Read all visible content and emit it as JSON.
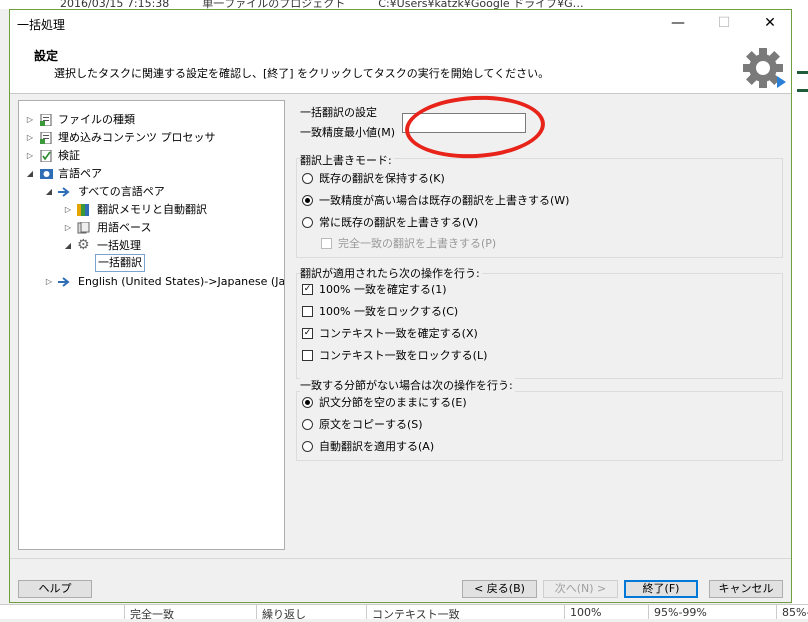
{
  "background": {
    "top_text": "2016/03/15 7:15:38　　　単一ファイルのプロジェクト　　　C:¥Users¥katzk¥Google ドライブ¥G…",
    "bottom_cells": [
      "完全一致",
      "繰り返し",
      "コンテキスト一致",
      "100%",
      "95%-99%",
      "85%-"
    ]
  },
  "window": {
    "title": "一括処理",
    "minimize": "—",
    "maximize": "☐",
    "close": "✕"
  },
  "header": {
    "title": "設定",
    "description": "選択したタスクに関連する設定を確認し、[終了] をクリックしてタスクの実行を開始してください。"
  },
  "tree": {
    "items": [
      {
        "label": "ファイルの種類",
        "arrow": "▷"
      },
      {
        "label": "埋め込みコンテンツ プロセッサ",
        "arrow": "▷"
      },
      {
        "label": "検証",
        "arrow": "▷"
      },
      {
        "label": "言語ペア",
        "arrow": "◢"
      },
      {
        "label": "すべての言語ペア",
        "arrow": "◢"
      },
      {
        "label": "翻訳メモリと自動翻訳",
        "arrow": "▷"
      },
      {
        "label": "用語ベース",
        "arrow": "▷"
      },
      {
        "label": "一括処理",
        "arrow": "◢"
      },
      {
        "label": "一括翻訳",
        "arrow": ""
      },
      {
        "label": "English (United States)->Japanese (Ja",
        "arrow": "▷"
      }
    ]
  },
  "settings": {
    "section_title": "一括翻訳の設定",
    "min_match_label": "一致精度最小値(M)",
    "min_match_value": "",
    "overwrite_mode": {
      "title": "翻訳上書きモード:",
      "options": [
        {
          "label": "既存の翻訳を保持する(K)",
          "selected": false
        },
        {
          "label": "一致精度が高い場合は既存の翻訳を上書きする(W)",
          "selected": true
        },
        {
          "label": "常に既存の翻訳を上書きする(V)",
          "selected": false
        }
      ],
      "sub_option": {
        "label": "完全一致の翻訳を上書きする(P)",
        "checked": false,
        "enabled": false
      }
    },
    "after_apply": {
      "title": "翻訳が適用されたら次の操作を行う:",
      "options": [
        {
          "label": "100% 一致を確定する(1)",
          "checked": true
        },
        {
          "label": "100% 一致をロックする(C)",
          "checked": false
        },
        {
          "label": "コンテキスト一致を確定する(X)",
          "checked": true
        },
        {
          "label": "コンテキスト一致をロックする(L)",
          "checked": false
        }
      ]
    },
    "no_match": {
      "title": "一致する分節がない場合は次の操作を行う:",
      "options": [
        {
          "label": "訳文分節を空のままにする(E)",
          "selected": true
        },
        {
          "label": "原文をコピーする(S)",
          "selected": false
        },
        {
          "label": "自動翻訳を適用する(A)",
          "selected": false
        }
      ]
    }
  },
  "footer": {
    "help": "ヘルプ",
    "back": "< 戻る(B)",
    "next": "次へ(N) >",
    "finish": "終了(F)",
    "cancel": "キャンセル"
  },
  "colors": {
    "annotation": "#e8231a",
    "window_border": "#6f9f3f",
    "accent": "#0078d7"
  }
}
